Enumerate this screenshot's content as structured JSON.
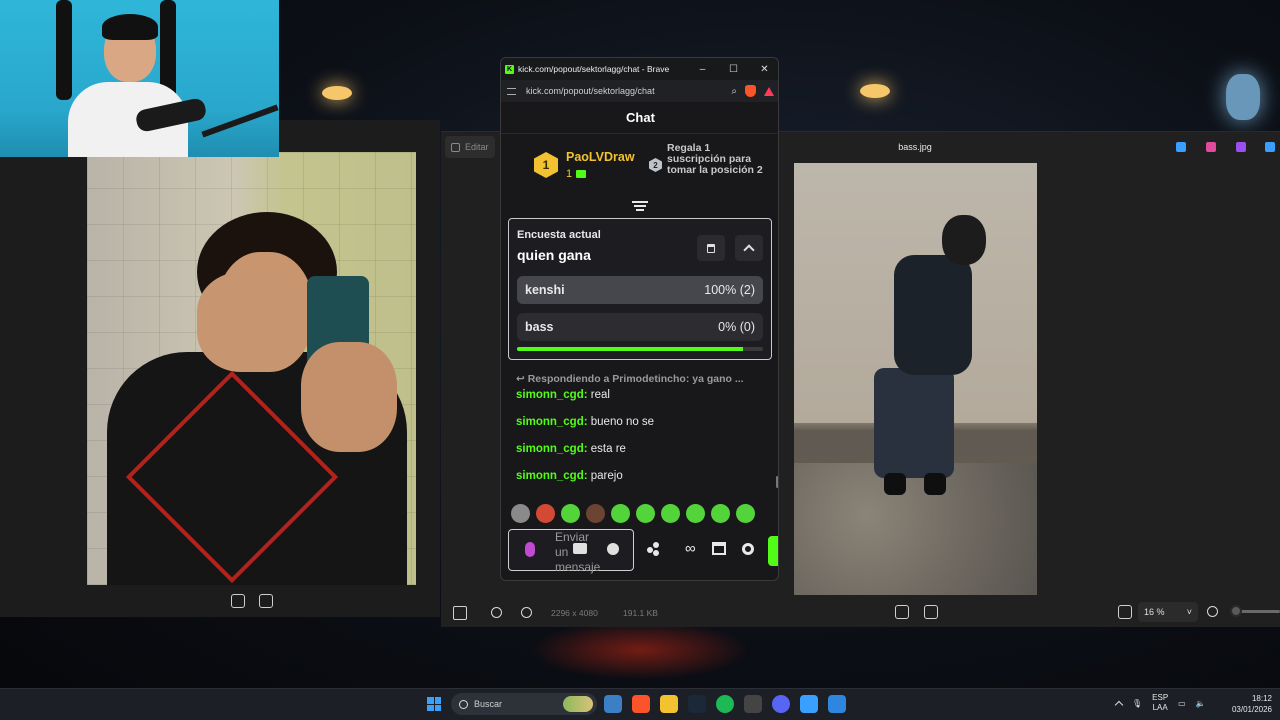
{
  "popup": {
    "window_title": "kick.com/popout/sektorlagg/chat - Brave",
    "url": "kick.com/popout/sektorlagg/chat",
    "chat_title": "Chat",
    "pinned": {
      "rank": "1",
      "username": "PaoLVDraw",
      "gift_count": "1",
      "rank2": "2",
      "note": "Regala 1 suscripción para tomar la posición 2"
    },
    "poll": {
      "label": "Encuesta actual",
      "question": "quien gana",
      "options": [
        {
          "name": "kenshi",
          "result": "100% (2)",
          "percent": 100
        },
        {
          "name": "bass",
          "result": "0% (0)",
          "percent": 0
        }
      ],
      "time_remaining_fraction": 0.92
    },
    "reply_context": "Respondiendo a Primodetincho: ya gano ...",
    "messages": [
      {
        "user": "simonn_cgd:",
        "text": "real"
      },
      {
        "user": "simonn_cgd:",
        "text": "bueno no se"
      },
      {
        "user": "simonn_cgd:",
        "text": "esta re"
      },
      {
        "user": "simonn_cgd:",
        "text": "parejo"
      }
    ],
    "composer_placeholder": "Enviar un mensaje"
  },
  "viewer": {
    "edit_label": "Editar",
    "file_name": "bass.jpg",
    "dimensions": "2296 x 4080",
    "file_size": "191.1 KB",
    "zoom": "16 %"
  },
  "taskbar": {
    "search_label": "Buscar",
    "lang_top": "ESP",
    "lang_bottom": "LAA",
    "time": "18:12",
    "date": "03/01/2026"
  },
  "colors": {
    "kick_green": "#53fc18",
    "gold": "#f2c230"
  }
}
